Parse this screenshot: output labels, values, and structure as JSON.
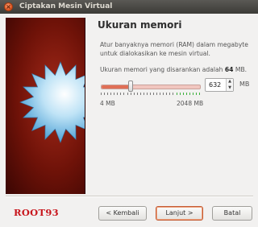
{
  "window": {
    "title": "Ciptakan Mesin Virtual",
    "close_glyph": "×"
  },
  "page": {
    "heading": "Ukuran memori",
    "description": "Atur banyaknya memori (RAM) dalam megabyte untuk dialokasikan ke mesin virtual.",
    "recommended_prefix": "Ukuran memori yang disarankan adalah",
    "recommended_value": "64",
    "recommended_suffix": "MB."
  },
  "memory": {
    "value": "632",
    "min_label": "4 MB",
    "max_label": "2048 MB",
    "unit": "MB",
    "min_mb": 4,
    "max_mb": 2048,
    "current_mb": 632,
    "spin_up_glyph": "▲",
    "spin_down_glyph": "▼"
  },
  "brand": {
    "text": "ROOT93",
    "color": "#c8161d"
  },
  "buttons": {
    "back": "< Kembali",
    "next": "Lanjut >",
    "cancel": "Batal"
  },
  "colors": {
    "accent": "#e06f56",
    "banner_bg": "#6e1208",
    "star": "#7fc3e8"
  },
  "icons": {
    "close": "close-icon",
    "spin_up": "spin-up-icon",
    "spin_down": "spin-down-icon",
    "banner": "starburst-illustration"
  }
}
